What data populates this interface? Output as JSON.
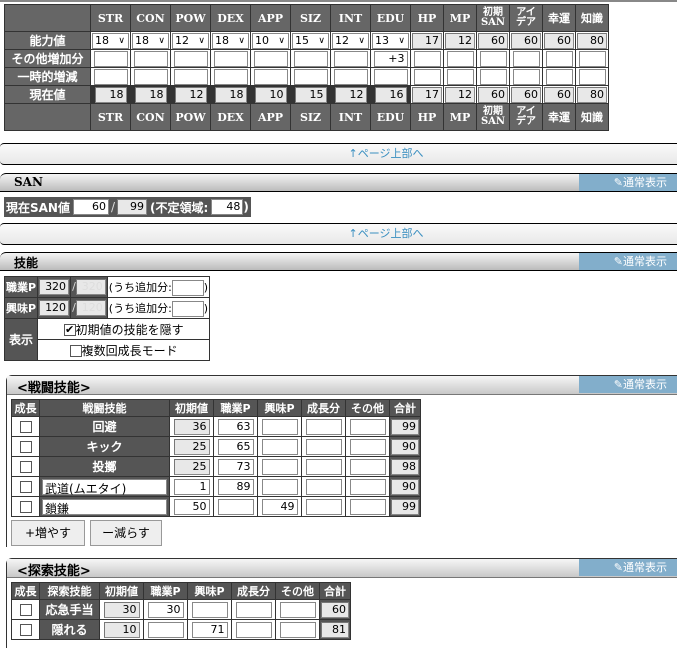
{
  "attributes": {
    "headers": [
      "STR",
      "CON",
      "POW",
      "DEX",
      "APP",
      "SIZ",
      "INT",
      "EDU",
      "HP",
      "MP",
      "初期SAN",
      "アイデア",
      "幸運",
      "知識"
    ],
    "header_lines": [
      [
        "STR"
      ],
      [
        "CON"
      ],
      [
        "POW"
      ],
      [
        "DEX"
      ],
      [
        "APP"
      ],
      [
        "SIZ"
      ],
      [
        "INT"
      ],
      [
        "EDU"
      ],
      [
        "HP"
      ],
      [
        "MP"
      ],
      [
        "初期",
        "SAN"
      ],
      [
        "アイ",
        "デア"
      ],
      [
        "幸運"
      ],
      [
        "知識"
      ]
    ],
    "row_labels": {
      "base": "能力値",
      "other": "その他増加分",
      "temp": "一時的増減",
      "current": "現在値"
    },
    "base_values": [
      "18",
      "18",
      "12",
      "18",
      "10",
      "15",
      "12",
      "13",
      "17",
      "12",
      "60",
      "60",
      "60",
      "80"
    ],
    "other_values": [
      "",
      "",
      "",
      "",
      "",
      "",
      "",
      "+3",
      "",
      "",
      "",
      "",
      "",
      ""
    ],
    "temp_values": [
      "",
      "",
      "",
      "",
      "",
      "",
      "",
      "",
      "",
      "",
      "",
      "",
      "",
      ""
    ],
    "current_values": [
      "18",
      "18",
      "12",
      "18",
      "10",
      "15",
      "12",
      "16",
      "17",
      "12",
      "60",
      "60",
      "60",
      "80"
    ]
  },
  "page_top_link": "↑ページ上部へ",
  "normal_view_label": "通常表示",
  "san": {
    "section_title": "SAN",
    "current_label": "現在SAN値",
    "current": "60",
    "separator": "/",
    "max": "99",
    "indefinite_label": "(不定領域:",
    "indefinite": "48",
    "close_paren": ")"
  },
  "skills": {
    "section_title": "技能",
    "occupation_label": "職業P",
    "occupation_remaining": "320",
    "occupation_total": "320",
    "interest_label": "興味P",
    "interest_remaining": "120",
    "interest_total": "120",
    "extra_label": "(うち追加分:",
    "occupation_extra": "",
    "interest_extra": "",
    "close_paren": ")",
    "slash": "/",
    "display_label": "表示",
    "hide_initial_label": "初期値の技能を隠す",
    "hide_initial_checked": true,
    "multi_growth_label": "複数回成長モード",
    "multi_growth_checked": false
  },
  "combat": {
    "title": "<戦闘技能>",
    "columns": [
      "成長",
      "戦闘技能",
      "初期値",
      "職業P",
      "興味P",
      "成長分",
      "その他",
      "合計"
    ],
    "rows": [
      {
        "name": "回避",
        "editable": false,
        "initial": "36",
        "occ": "63",
        "int": "",
        "growth": "",
        "other": "",
        "total": "99"
      },
      {
        "name": "キック",
        "editable": false,
        "initial": "25",
        "occ": "65",
        "int": "",
        "growth": "",
        "other": "",
        "total": "90"
      },
      {
        "name": "投擲",
        "editable": false,
        "initial": "25",
        "occ": "73",
        "int": "",
        "growth": "",
        "other": "",
        "total": "98"
      },
      {
        "name": "武道(ムエタイ)",
        "editable": true,
        "initial": "1",
        "occ": "89",
        "int": "",
        "growth": "",
        "other": "",
        "total": "90"
      },
      {
        "name": "鎖鎌",
        "editable": true,
        "initial": "50",
        "occ": "",
        "int": "49",
        "growth": "",
        "other": "",
        "total": "99"
      }
    ],
    "add_button": "+増やす",
    "remove_button": "ー減らす"
  },
  "explore": {
    "title": "<探索技能>",
    "columns": [
      "成長",
      "探索技能",
      "初期値",
      "職業P",
      "興味P",
      "成長分",
      "その他",
      "合計"
    ],
    "rows": [
      {
        "name": "応急手当",
        "initial": "30",
        "occ": "30",
        "int": "",
        "growth": "",
        "other": "",
        "total": "60"
      },
      {
        "name": "隠れる",
        "initial": "10",
        "occ": "",
        "int": "71",
        "growth": "",
        "other": "",
        "total": "81"
      }
    ]
  }
}
